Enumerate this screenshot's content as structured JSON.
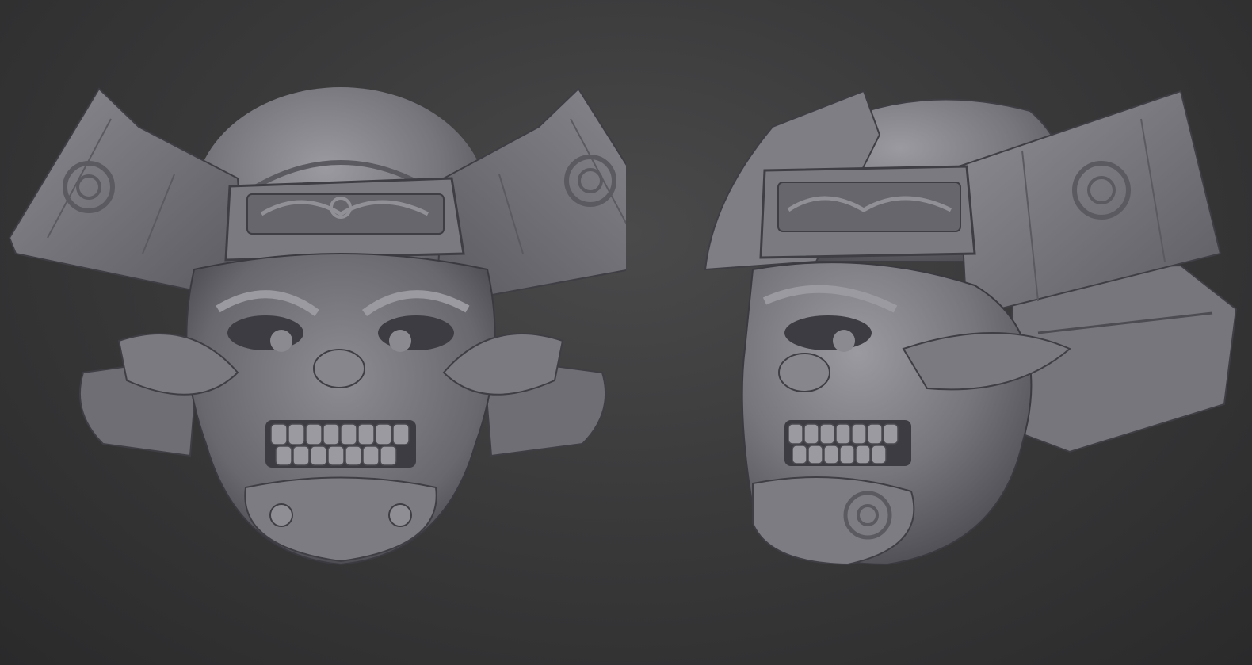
{
  "scene": {
    "subject": "samurai-skull-helmet-sculpt",
    "views": [
      "front",
      "three-quarter"
    ],
    "colors": {
      "background": "#3a3a3b",
      "clay_light": "#8e8e93",
      "clay_mid": "#727278",
      "clay_dark": "#4a4a50",
      "clay_shadow": "#2e2e33"
    }
  }
}
